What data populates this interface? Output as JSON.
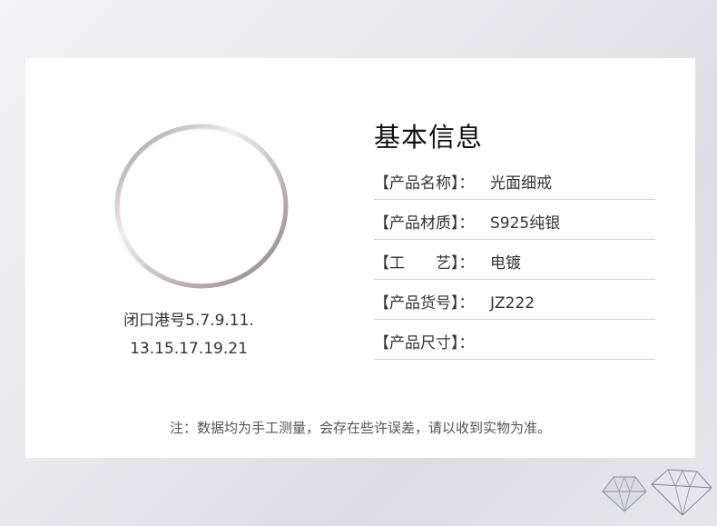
{
  "product_image": {
    "caption_line1": "闭口港号5.7.9.11.",
    "caption_line2": "13.15.17.19.21"
  },
  "info": {
    "title": "基本信息",
    "rows": [
      {
        "label": "【产品名称】：",
        "value": "光面细戒"
      },
      {
        "label": "【产品材质】：",
        "value": "S925纯银"
      },
      {
        "label": "【工　　艺】：",
        "value": "电镀"
      },
      {
        "label": "【产品货号】：",
        "value": "JZ222"
      },
      {
        "label": "【产品尺寸】：",
        "value": ""
      }
    ]
  },
  "note": "注：数据均为手工测量，会存在些许误差，请以收到实物为准。",
  "colors": {
    "accent_ring": "#d8cfcf",
    "divider": "#cfcfcf",
    "text": "#333333"
  },
  "icons": [
    "ring-image",
    "diamond-icon"
  ]
}
